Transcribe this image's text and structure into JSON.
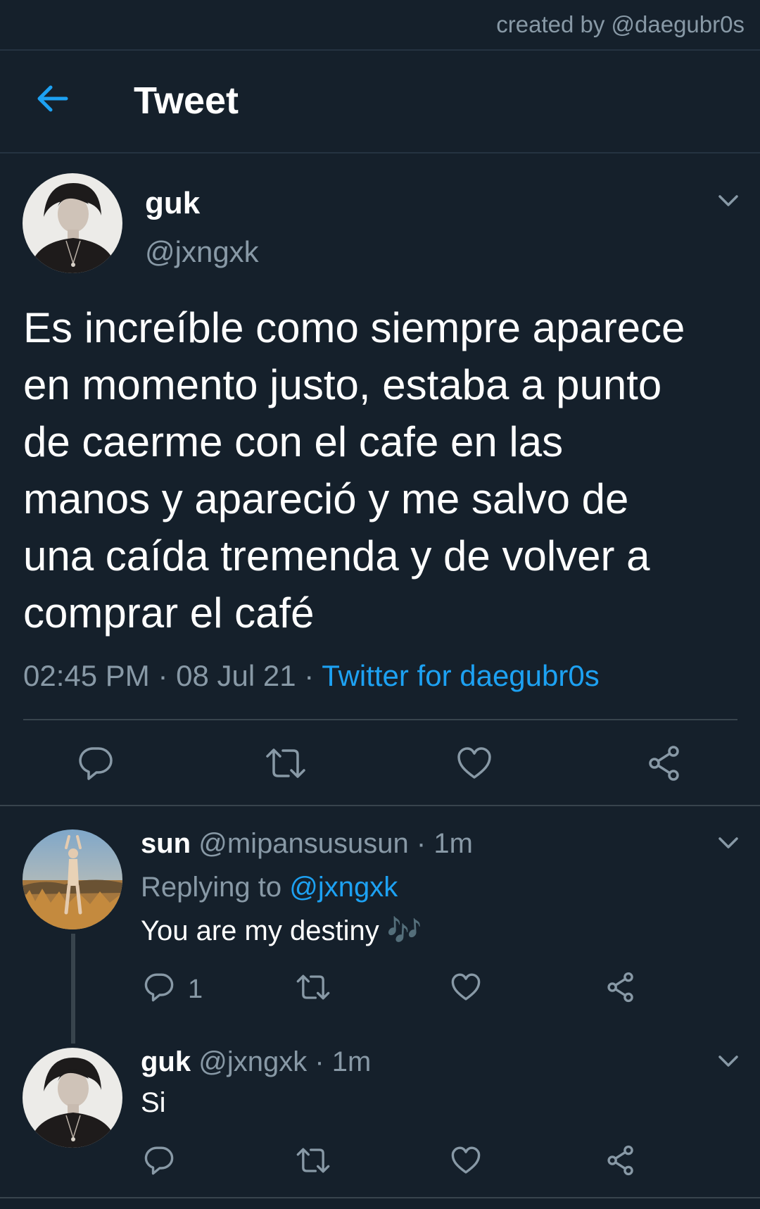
{
  "credit": "created by @daegubr0s",
  "header": {
    "title": "Tweet"
  },
  "tweet": {
    "name": "guk",
    "handle": "@jxngxk",
    "lines": [
      "Es increíble como siempre aparece",
      "en momento justo, estaba a punto",
      "de caerme con el cafe en las",
      "manos y apareció y me salvo de",
      "una caída tremenda y de volver a",
      "comprar el café"
    ],
    "time": "02:45 PM",
    "date": "08 Jul 21",
    "sep": "·",
    "source": "Twitter for daegubr0s"
  },
  "replies": [
    {
      "name": "sun",
      "handle": "@mipansususun",
      "age": "· 1m",
      "replying_prefix": "Replying to ",
      "replying_handle": "@jxngxk",
      "text": "You are my destiny ",
      "emoji": "🎶",
      "reply_count": "1"
    },
    {
      "name": "guk",
      "handle": "@jxngxk",
      "age": "· 1m",
      "text": "Si"
    }
  ],
  "colors": {
    "background": "#15202b",
    "accent": "#1da1f2",
    "muted": "#8899a6",
    "divider": "#38444d"
  },
  "icons": [
    "back-arrow-icon",
    "chevron-down-icon",
    "reply-icon",
    "retweet-icon",
    "like-icon",
    "share-icon"
  ]
}
